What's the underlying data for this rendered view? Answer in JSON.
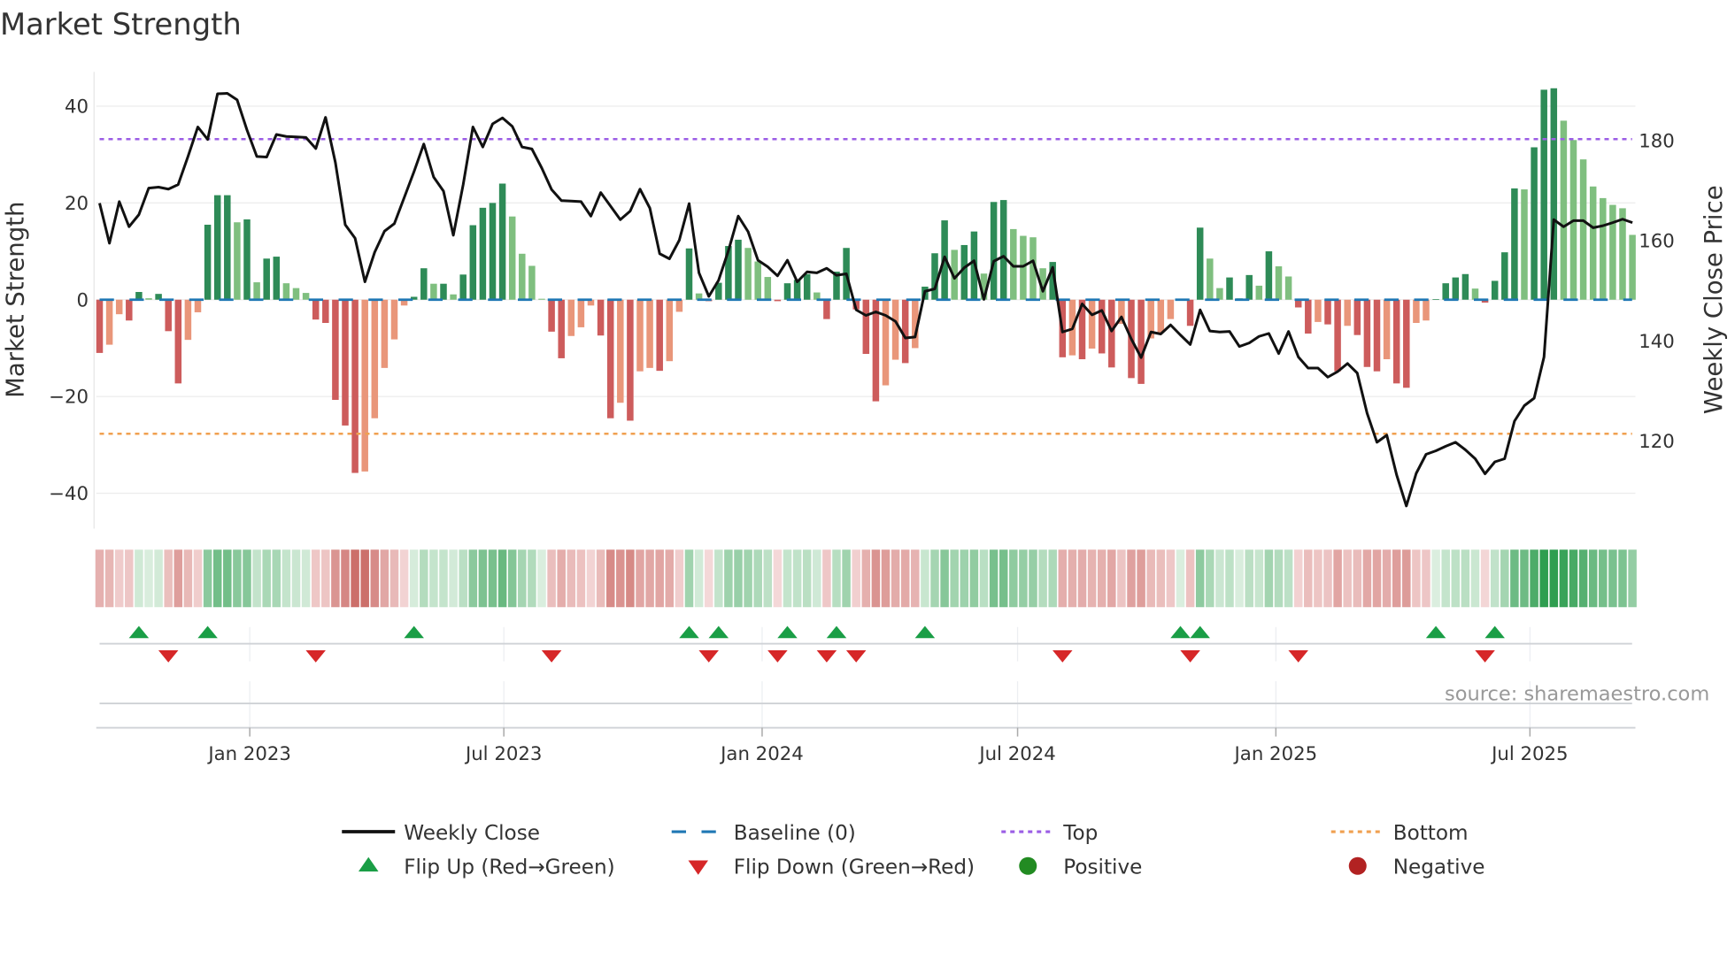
{
  "chart_data": {
    "type": "bar",
    "title": "Market Strength",
    "ylabel": "Market Strength",
    "y2label": "Weekly Close Price",
    "ylim": [
      -48,
      48
    ],
    "y2lim": [
      99,
      200
    ],
    "yticks": [
      {
        "v": 40,
        "label": "40"
      },
      {
        "v": 20,
        "label": "20"
      },
      {
        "v": 0,
        "label": "0"
      },
      {
        "v": -20,
        "label": "−20"
      },
      {
        "v": -40,
        "label": "−40"
      }
    ],
    "y2ticks": [
      {
        "v": 180,
        "label": "180"
      },
      {
        "v": 160,
        "label": "160"
      },
      {
        "v": 140,
        "label": "140"
      },
      {
        "v": 120,
        "label": "120"
      }
    ],
    "xticks": [
      "Jan 2023",
      "Jul 2023",
      "Jan 2024",
      "Jul 2024",
      "Jan 2025",
      "Jul 2025"
    ],
    "top_level": 33.2,
    "bottom_level": -27.7,
    "baseline": 0,
    "grid": true,
    "legend_placement": "bottom",
    "colors": {
      "pos_strong": "#2e8b57",
      "pos_weak": "#7fbf7f",
      "neg_strong": "#cd5c5c",
      "neg_weak": "#e9967a",
      "baseline": "#1f77b4",
      "top": "#9b5de5",
      "bottom": "#f0a050",
      "close": "#111111",
      "flip_up": "#1a9e46",
      "flip_down": "#d62728",
      "positive": "#228b22",
      "negative": "#b22222"
    },
    "strength": [
      -11,
      -9.3,
      -3,
      -4.3,
      1.6,
      0.3,
      1.2,
      -6.5,
      -17.3,
      -8.3,
      -2.6,
      15.5,
      21.6,
      21.6,
      16,
      16.6,
      3.6,
      8.5,
      8.9,
      3.4,
      2.4,
      1.4,
      -4.1,
      -4.8,
      -20.7,
      -26,
      -35.8,
      -35.5,
      -24.5,
      -14.1,
      -8.2,
      -1.2,
      0.6,
      6.5,
      3.3,
      3.3,
      1.1,
      5.2,
      15.4,
      19,
      20,
      24,
      17.2,
      9.5,
      7,
      0.2,
      -6.6,
      -12.1,
      -7.5,
      -5.7,
      -1.2,
      -7.4,
      -24.5,
      -21.3,
      -25,
      -14.8,
      -14.1,
      -14.7,
      -12.7,
      -2.5,
      10.6,
      1.3,
      -0.3,
      3.5,
      11.1,
      12.4,
      10.7,
      7.9,
      4.7,
      -0.3,
      3.4,
      4.1,
      5.3,
      1.5,
      -4,
      5.8,
      10.7,
      -2,
      -11.2,
      -21,
      -17.7,
      -12.4,
      -13.1,
      -10,
      2.7,
      9.6,
      16.4,
      10.3,
      11.3,
      14.1,
      5.4,
      20.2,
      20.6,
      14.6,
      13.2,
      12.9,
      6.5,
      7.8,
      -11.9,
      -11.5,
      -12.3,
      -10.1,
      -11.1,
      -14,
      -5,
      -16.2,
      -17.4,
      -8,
      -6.8,
      -4,
      0.2,
      -5.4,
      14.9,
      8.5,
      2.4,
      4.6,
      0.3,
      5.1,
      2.9,
      10,
      6.9,
      4.8,
      -1.6,
      -7,
      -4.6,
      -5.1,
      -14.8,
      -5.4,
      -7.3,
      -13.9,
      -14.8,
      -12.3,
      -17.3,
      -18.2,
      -4.8,
      -4.3,
      0.1,
      3.4,
      4.6,
      5.3,
      2.3,
      -0.6,
      3.9,
      9.8,
      23,
      22.8,
      31.5,
      43.4,
      43.7,
      37,
      33,
      29,
      23.4,
      21,
      19.6,
      18.9,
      13.4
    ],
    "weekly_close": [
      167.5,
      159.5,
      167.8,
      162.8,
      165.2,
      170.5,
      170.7,
      170.3,
      171.2,
      176.8,
      182.7,
      180.2,
      189.3,
      189.4,
      188.1,
      182.1,
      176.8,
      176.7,
      181.2,
      180.8,
      180.7,
      180.6,
      178.4,
      184.6,
      175.6,
      163.2,
      160.5,
      151.8,
      157.7,
      161.9,
      163.4,
      168.6,
      173.8,
      179.3,
      172.7,
      169.9,
      161.1,
      171.2,
      182.7,
      178.7,
      183.3,
      184.5,
      182.8,
      178.7,
      178.3,
      174.5,
      170.2,
      168,
      167.9,
      167.8,
      164.9,
      169.6,
      166.9,
      164.2,
      165.9,
      170.3,
      166.5,
      157.4,
      156.4,
      160.1,
      167.4,
      153.6,
      148.9,
      152.1,
      158,
      164.9,
      161.8,
      156.1,
      154.8,
      153,
      156.1,
      151.8,
      153.8,
      153.6,
      154.5,
      153.1,
      153.4,
      146.2,
      145.1,
      145.8,
      145.1,
      143.9,
      140.6,
      140.8,
      149.9,
      150.4,
      156.8,
      152.5,
      154.6,
      156,
      148.3,
      155.9,
      156.9,
      154.9,
      154.9,
      156,
      149.9,
      154.7,
      141.8,
      142.4,
      147.4,
      145.2,
      146.1,
      142,
      144.8,
      140.4,
      136.7,
      141.8,
      141.4,
      143.2,
      141.2,
      139.3,
      146.2,
      142,
      141.8,
      141.9,
      138.9,
      139.6,
      140.9,
      141.5,
      137.5,
      141.9,
      136.8,
      134.6,
      134.6,
      132.8,
      133.9,
      135.5,
      133.6,
      125.6,
      119.8,
      121.2,
      113.3,
      107.1,
      113.6,
      117.4,
      118.1,
      119,
      119.8,
      118.3,
      116.5,
      113.5,
      115.9,
      116.5,
      124,
      127.1,
      128.6,
      136.8,
      164.2,
      162.8,
      164,
      164,
      162.6,
      163,
      163.6,
      164.3,
      163.6
    ],
    "legend": {
      "weekly_close": "Weekly Close",
      "baseline": "Baseline (0)",
      "top": "Top",
      "bottom": "Bottom",
      "flip_up": "Flip Up (Red→Green)",
      "flip_down": "Flip Down (Green→Red)",
      "positive": "Positive",
      "negative": "Negative"
    },
    "source": "source: sharemaestro.com"
  }
}
